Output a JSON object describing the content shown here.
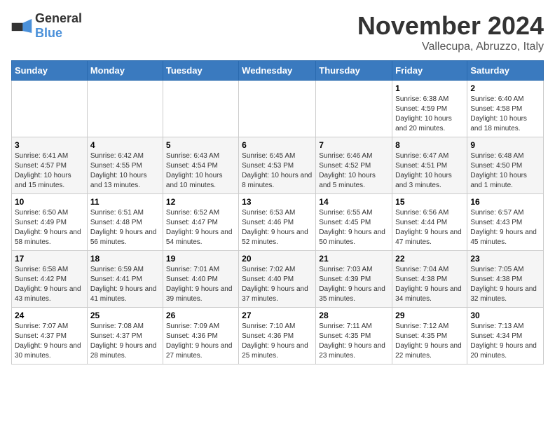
{
  "header": {
    "logo_general": "General",
    "logo_blue": "Blue",
    "month_title": "November 2024",
    "location": "Vallecupa, Abruzzo, Italy"
  },
  "days_of_week": [
    "Sunday",
    "Monday",
    "Tuesday",
    "Wednesday",
    "Thursday",
    "Friday",
    "Saturday"
  ],
  "weeks": [
    [
      {
        "day": "",
        "info": ""
      },
      {
        "day": "",
        "info": ""
      },
      {
        "day": "",
        "info": ""
      },
      {
        "day": "",
        "info": ""
      },
      {
        "day": "",
        "info": ""
      },
      {
        "day": "1",
        "info": "Sunrise: 6:38 AM\nSunset: 4:59 PM\nDaylight: 10 hours and 20 minutes."
      },
      {
        "day": "2",
        "info": "Sunrise: 6:40 AM\nSunset: 4:58 PM\nDaylight: 10 hours and 18 minutes."
      }
    ],
    [
      {
        "day": "3",
        "info": "Sunrise: 6:41 AM\nSunset: 4:57 PM\nDaylight: 10 hours and 15 minutes."
      },
      {
        "day": "4",
        "info": "Sunrise: 6:42 AM\nSunset: 4:55 PM\nDaylight: 10 hours and 13 minutes."
      },
      {
        "day": "5",
        "info": "Sunrise: 6:43 AM\nSunset: 4:54 PM\nDaylight: 10 hours and 10 minutes."
      },
      {
        "day": "6",
        "info": "Sunrise: 6:45 AM\nSunset: 4:53 PM\nDaylight: 10 hours and 8 minutes."
      },
      {
        "day": "7",
        "info": "Sunrise: 6:46 AM\nSunset: 4:52 PM\nDaylight: 10 hours and 5 minutes."
      },
      {
        "day": "8",
        "info": "Sunrise: 6:47 AM\nSunset: 4:51 PM\nDaylight: 10 hours and 3 minutes."
      },
      {
        "day": "9",
        "info": "Sunrise: 6:48 AM\nSunset: 4:50 PM\nDaylight: 10 hours and 1 minute."
      }
    ],
    [
      {
        "day": "10",
        "info": "Sunrise: 6:50 AM\nSunset: 4:49 PM\nDaylight: 9 hours and 58 minutes."
      },
      {
        "day": "11",
        "info": "Sunrise: 6:51 AM\nSunset: 4:48 PM\nDaylight: 9 hours and 56 minutes."
      },
      {
        "day": "12",
        "info": "Sunrise: 6:52 AM\nSunset: 4:47 PM\nDaylight: 9 hours and 54 minutes."
      },
      {
        "day": "13",
        "info": "Sunrise: 6:53 AM\nSunset: 4:46 PM\nDaylight: 9 hours and 52 minutes."
      },
      {
        "day": "14",
        "info": "Sunrise: 6:55 AM\nSunset: 4:45 PM\nDaylight: 9 hours and 50 minutes."
      },
      {
        "day": "15",
        "info": "Sunrise: 6:56 AM\nSunset: 4:44 PM\nDaylight: 9 hours and 47 minutes."
      },
      {
        "day": "16",
        "info": "Sunrise: 6:57 AM\nSunset: 4:43 PM\nDaylight: 9 hours and 45 minutes."
      }
    ],
    [
      {
        "day": "17",
        "info": "Sunrise: 6:58 AM\nSunset: 4:42 PM\nDaylight: 9 hours and 43 minutes."
      },
      {
        "day": "18",
        "info": "Sunrise: 6:59 AM\nSunset: 4:41 PM\nDaylight: 9 hours and 41 minutes."
      },
      {
        "day": "19",
        "info": "Sunrise: 7:01 AM\nSunset: 4:40 PM\nDaylight: 9 hours and 39 minutes."
      },
      {
        "day": "20",
        "info": "Sunrise: 7:02 AM\nSunset: 4:40 PM\nDaylight: 9 hours and 37 minutes."
      },
      {
        "day": "21",
        "info": "Sunrise: 7:03 AM\nSunset: 4:39 PM\nDaylight: 9 hours and 35 minutes."
      },
      {
        "day": "22",
        "info": "Sunrise: 7:04 AM\nSunset: 4:38 PM\nDaylight: 9 hours and 34 minutes."
      },
      {
        "day": "23",
        "info": "Sunrise: 7:05 AM\nSunset: 4:38 PM\nDaylight: 9 hours and 32 minutes."
      }
    ],
    [
      {
        "day": "24",
        "info": "Sunrise: 7:07 AM\nSunset: 4:37 PM\nDaylight: 9 hours and 30 minutes."
      },
      {
        "day": "25",
        "info": "Sunrise: 7:08 AM\nSunset: 4:37 PM\nDaylight: 9 hours and 28 minutes."
      },
      {
        "day": "26",
        "info": "Sunrise: 7:09 AM\nSunset: 4:36 PM\nDaylight: 9 hours and 27 minutes."
      },
      {
        "day": "27",
        "info": "Sunrise: 7:10 AM\nSunset: 4:36 PM\nDaylight: 9 hours and 25 minutes."
      },
      {
        "day": "28",
        "info": "Sunrise: 7:11 AM\nSunset: 4:35 PM\nDaylight: 9 hours and 23 minutes."
      },
      {
        "day": "29",
        "info": "Sunrise: 7:12 AM\nSunset: 4:35 PM\nDaylight: 9 hours and 22 minutes."
      },
      {
        "day": "30",
        "info": "Sunrise: 7:13 AM\nSunset: 4:34 PM\nDaylight: 9 hours and 20 minutes."
      }
    ]
  ]
}
